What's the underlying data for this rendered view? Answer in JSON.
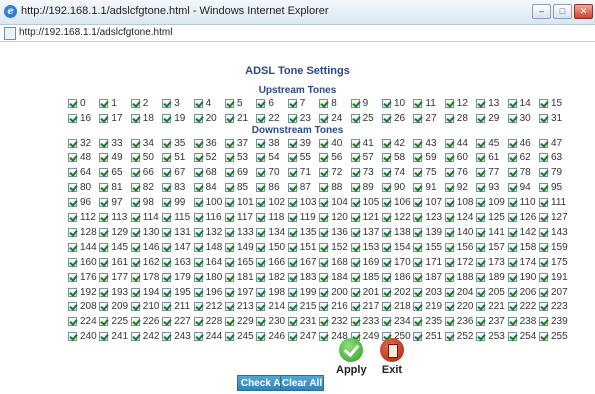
{
  "window": {
    "title": "http://192.168.1.1/adslcfgtone.html - Windows Internet Explorer",
    "address": "http://192.168.1.1/adslcfgtone.html",
    "buttons": [
      "–",
      "□",
      "✕"
    ]
  },
  "page": {
    "heading": "ADSL Tone Settings",
    "upstream_label": "Upstream Tones",
    "downstream_label": "Downstream Tones",
    "upstream_range": [
      0,
      31
    ],
    "downstream_range": [
      32,
      255
    ],
    "all_checked": true
  },
  "actions": {
    "check_all": "Check All",
    "clear_all": "Clear All",
    "apply": "Apply",
    "exit": "Exit"
  },
  "colors": {
    "heading": "#2b4a8b",
    "button": "#2f84bd",
    "apply": "#2e9a26",
    "exit": "#a72313"
  }
}
